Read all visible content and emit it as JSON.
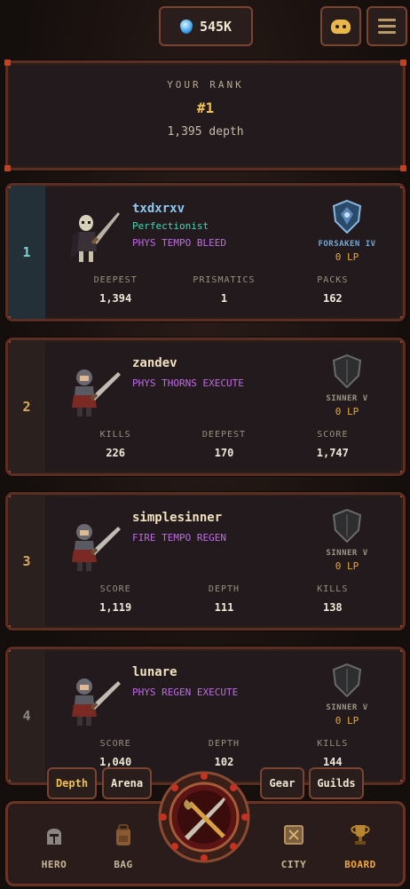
{
  "top_bar": {
    "currency_value": "545K",
    "currency_icon": "soul-gem-icon",
    "discord_icon": "discord-icon",
    "menu_icon": "menu-icon"
  },
  "your_rank": {
    "label": "YOUR RANK",
    "rank": "#1",
    "depth": "1,395 depth"
  },
  "leaderboard": [
    {
      "position": "1",
      "name": "txdxrxv",
      "title": "Perfectionist",
      "tags": "PHYS TEMPO BLEED",
      "badge_name": "FORSAKEN IV",
      "lp": "0 LP",
      "stats": [
        {
          "label": "DEEPEST",
          "value": "1,394"
        },
        {
          "label": "PRISMATICS",
          "value": "1"
        },
        {
          "label": "PACKS",
          "value": "162"
        }
      ]
    },
    {
      "position": "2",
      "name": "zandev",
      "title": "",
      "tags": "PHYS THORNS EXECUTE",
      "badge_name": "SINNER V",
      "lp": "0 LP",
      "stats": [
        {
          "label": "KILLS",
          "value": "226"
        },
        {
          "label": "DEEPEST",
          "value": "170"
        },
        {
          "label": "SCORE",
          "value": "1,747"
        }
      ]
    },
    {
      "position": "3",
      "name": "simplesinner",
      "title": "",
      "tags": "FIRE TEMPO REGEN",
      "badge_name": "SINNER V",
      "lp": "0 LP",
      "stats": [
        {
          "label": "SCORE",
          "value": "1,119"
        },
        {
          "label": "DEPTH",
          "value": "111"
        },
        {
          "label": "KILLS",
          "value": "138"
        }
      ]
    },
    {
      "position": "4",
      "name": "lunare",
      "title": "",
      "tags": "PHYS REGEN EXECUTE",
      "badge_name": "SINNER V",
      "lp": "0 LP",
      "stats": [
        {
          "label": "SCORE",
          "value": "1,040"
        },
        {
          "label": "DEPTH",
          "value": "102"
        },
        {
          "label": "KILLS",
          "value": "144"
        }
      ]
    }
  ],
  "sub_tabs": {
    "depth": "Depth",
    "arena": "Arena",
    "gear": "Gear",
    "guilds": "Guilds"
  },
  "bottom_nav": {
    "hero": "HERO",
    "bag": "BAG",
    "city": "CITY",
    "board": "BOARD",
    "active": "BOARD"
  },
  "colors": {
    "accent_gold": "#f2c24e",
    "tag_purple": "#c06ae8",
    "title_teal": "#48d6b8",
    "lp_orange": "#e8a838",
    "frame_red": "#c8401e"
  }
}
